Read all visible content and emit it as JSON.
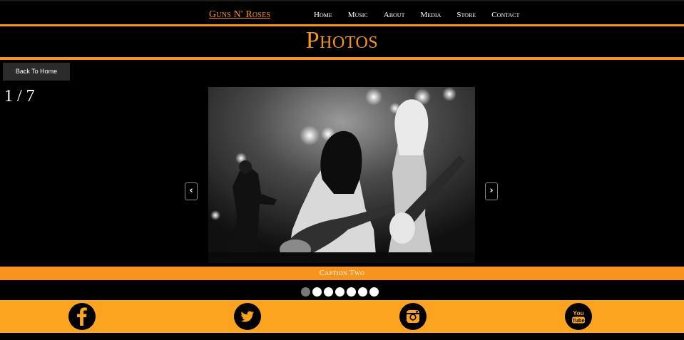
{
  "nav": {
    "brand": "Guns N' Roses",
    "links": [
      "Home",
      "Music",
      "About",
      "Media",
      "Store",
      "Contact"
    ]
  },
  "page": {
    "title": "Photos",
    "back_label": "Back To Home"
  },
  "slider": {
    "counter": "1 / 7",
    "prev_icon": "chevron-left-icon",
    "next_icon": "chevron-right-icon",
    "caption": "Caption Two",
    "current_slide": 1,
    "total_slides": 7
  },
  "footer": {
    "icons": [
      "facebook-icon",
      "twitter-icon",
      "instagram-icon",
      "youtube-icon"
    ],
    "youtube_text": [
      "You",
      "Tube"
    ]
  },
  "colors": {
    "accent": "#f7941d",
    "footer_bg": "#fca31f",
    "background": "#000000",
    "back_button": "#2b2b2b"
  }
}
